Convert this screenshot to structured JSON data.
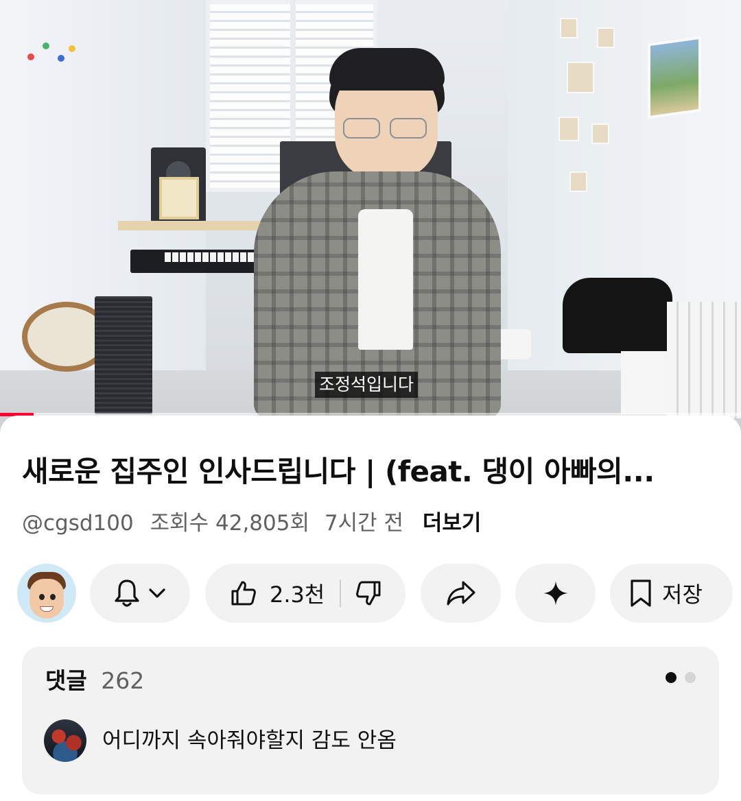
{
  "video": {
    "caption": "조정석입니다",
    "progress_fraction": 0.045
  },
  "details": {
    "title": "새로운 집주인 인사드립니다 | (feat. 댕이 아빠의...",
    "channel_handle": "@cgsd100",
    "views": "조회수 42,805회",
    "age": "7시간 전",
    "more_label": "더보기"
  },
  "actions": {
    "like_count": "2.3천",
    "save_label": "저장"
  },
  "comments": {
    "label": "댓글",
    "count": "262",
    "top_comment": "어디까지 속아줘야할지 감도 안옴"
  },
  "icons": {
    "bell": "bell-icon",
    "chevron": "chevron-down-icon",
    "like": "thumbs-up-icon",
    "dislike": "thumbs-down-icon",
    "share": "share-arrow-icon",
    "ai": "sparkle-icon",
    "save": "bookmark-icon"
  },
  "colors": {
    "accent_red": "#ff0033",
    "pill_bg": "#f2f2f2",
    "text_primary": "#0f0f0f",
    "text_secondary": "#606060"
  }
}
